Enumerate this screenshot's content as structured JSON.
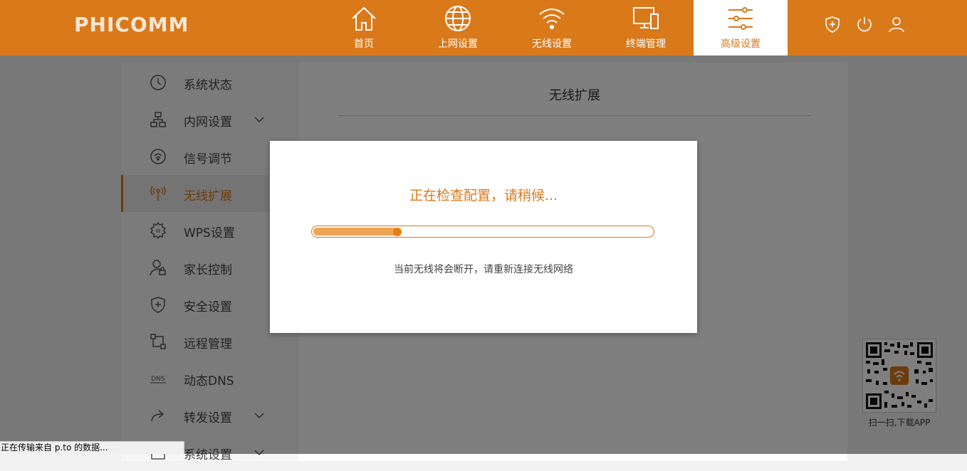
{
  "brand": {
    "logo": "PHICOMM"
  },
  "colors": {
    "accent": "#d9791a",
    "overlay": "rgba(0,0,0,0.5)"
  },
  "nav": {
    "items": [
      {
        "label": "首页",
        "icon": "home-icon"
      },
      {
        "label": "上网设置",
        "icon": "globe-icon"
      },
      {
        "label": "无线设置",
        "icon": "wifi-icon"
      },
      {
        "label": "终端管理",
        "icon": "devices-icon"
      },
      {
        "label": "高级设置",
        "icon": "sliders-icon",
        "active": true
      }
    ],
    "right_icons": [
      "shield-plus-icon",
      "power-icon",
      "user-icon"
    ]
  },
  "sidebar": {
    "items": [
      {
        "label": "系统状态",
        "icon": "clock-icon"
      },
      {
        "label": "内网设置",
        "icon": "network-icon",
        "expandable": true
      },
      {
        "label": "信号调节",
        "icon": "signal-icon"
      },
      {
        "label": "无线扩展",
        "icon": "antenna-icon",
        "active": true
      },
      {
        "label": "WPS设置",
        "icon": "wps-gear-icon"
      },
      {
        "label": "家长控制",
        "icon": "parent-lock-icon"
      },
      {
        "label": "安全设置",
        "icon": "shield-icon"
      },
      {
        "label": "远程管理",
        "icon": "remote-icon"
      },
      {
        "label": "动态DNS",
        "icon": "dns-icon"
      },
      {
        "label": "转发设置",
        "icon": "forward-icon",
        "expandable": true
      },
      {
        "label": "系统设置",
        "icon": "system-icon",
        "expandable": true
      }
    ]
  },
  "content": {
    "title": "无线扩展"
  },
  "modal": {
    "title": "正在检查配置，请稍候...",
    "progress": 0.25,
    "note": "当前无线将会断开，请重新连接无线网络"
  },
  "qr": {
    "label": "扫一扫,下载APP"
  },
  "statusbar": {
    "text": "正在传输来自 p.to 的数据..."
  }
}
